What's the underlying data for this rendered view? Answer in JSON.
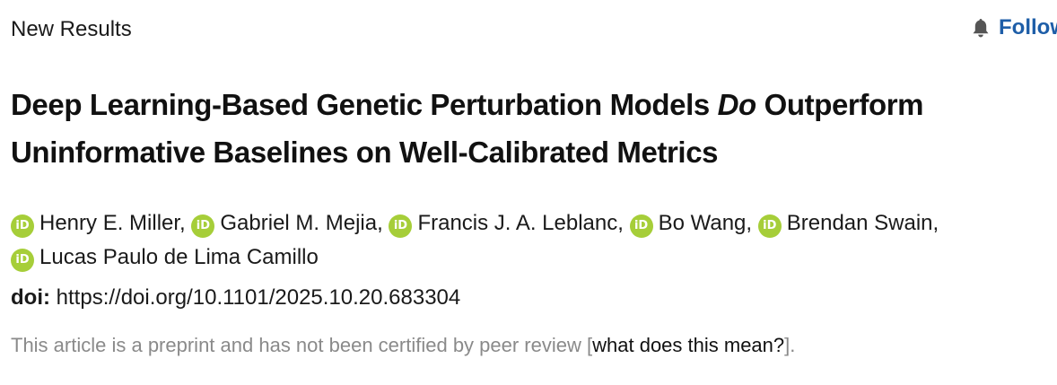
{
  "section_label": "New Results",
  "follow": {
    "icon": "bell-icon",
    "label": "Follow"
  },
  "title": {
    "part1": "Deep Learning-Based Genetic Perturbation Models ",
    "emphasis": "Do",
    "part2": " Outperform Uninformative Baselines on Well-Calibrated Metrics"
  },
  "authors": [
    {
      "name": "Henry E. Miller",
      "sep": ",",
      "orcid_badge": "iD"
    },
    {
      "name": "Gabriel M. Mejia",
      "sep": ",",
      "orcid_badge": "iD"
    },
    {
      "name": "Francis J. A. Leblanc",
      "sep": ",",
      "orcid_badge": "iD"
    },
    {
      "name": "Bo Wang",
      "sep": ",",
      "orcid_badge": "iD"
    },
    {
      "name": "Brendan Swain",
      "sep": ",",
      "orcid_badge": "iD"
    },
    {
      "name": "Lucas Paulo de Lima Camillo",
      "sep": "",
      "orcid_badge": "iD"
    }
  ],
  "doi": {
    "label": "doi:",
    "url": "https://doi.org/10.1101/2025.10.20.683304"
  },
  "notice": {
    "text": "This article is a preprint and has not been certified by peer review ",
    "bracket_open": "[",
    "link": "what does this mean?",
    "bracket_close": "]",
    "end": "."
  },
  "colors": {
    "follow_blue": "#1e5ea8",
    "orcid_green": "#a6ce39",
    "notice_gray": "#8a8a8a"
  }
}
